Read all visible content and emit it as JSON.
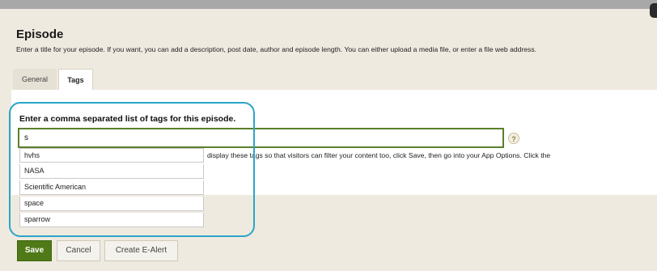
{
  "header": {
    "title": "Episode",
    "intro": "Enter a title for your episode. If you want, you can add a description, post date, author and episode length. You can either upload a media file, or enter a file web address."
  },
  "tabs": [
    {
      "label": "General",
      "active": false
    },
    {
      "label": "Tags",
      "active": true
    }
  ],
  "tags_form": {
    "prompt": "Enter a comma separated list of tags for this episode.",
    "input_value": "s",
    "help_icon_glyph": "?",
    "tip_text": "display these tags so that visitors can filter your content too, click Save, then go into your App Options. Click the",
    "suggestions": [
      "hvhs",
      "NASA",
      "Scientific American",
      "space",
      "sparrow"
    ]
  },
  "actions": {
    "save": "Save",
    "cancel": "Cancel",
    "create_alert": "Create E-Alert"
  },
  "colors": {
    "save_button": "#4f7a17",
    "input_border": "#5b7f2a",
    "highlight": "#2aa5c9"
  },
  "icons": {
    "help": "help-icon"
  }
}
